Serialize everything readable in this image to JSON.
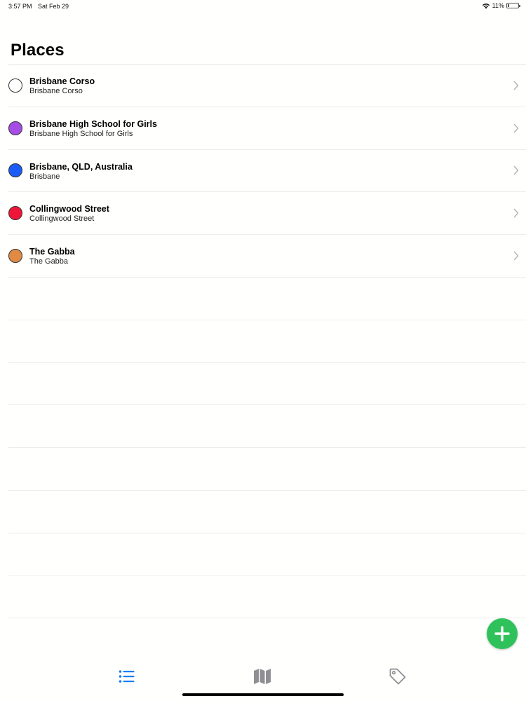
{
  "status_bar": {
    "time": "3:57 PM",
    "date": "Sat Feb 29",
    "battery_percent_label": "11%",
    "battery_level": 0.11
  },
  "page": {
    "title": "Places"
  },
  "places": [
    {
      "title": "Brisbane Corso",
      "subtitle": "Brisbane Corso",
      "color": "#ffffff"
    },
    {
      "title": "Brisbane High School for Girls",
      "subtitle": "Brisbane High School for Girls",
      "color": "#a64de6"
    },
    {
      "title": "Brisbane, QLD, Australia",
      "subtitle": "Brisbane",
      "color": "#1a5cf5"
    },
    {
      "title": "Collingwood Street",
      "subtitle": "Collingwood Street",
      "color": "#ee1538"
    },
    {
      "title": "The Gabba",
      "subtitle": "The Gabba",
      "color": "#e08a44"
    }
  ],
  "colors": {
    "accent": "#1a7cf5",
    "fab": "#2fc25b",
    "tab_inactive": "#8e8e93"
  },
  "tabs": [
    {
      "icon": "list-icon",
      "active": true
    },
    {
      "icon": "map-icon",
      "active": false
    },
    {
      "icon": "tag-icon",
      "active": false
    }
  ],
  "fab": {
    "icon": "plus-icon"
  }
}
